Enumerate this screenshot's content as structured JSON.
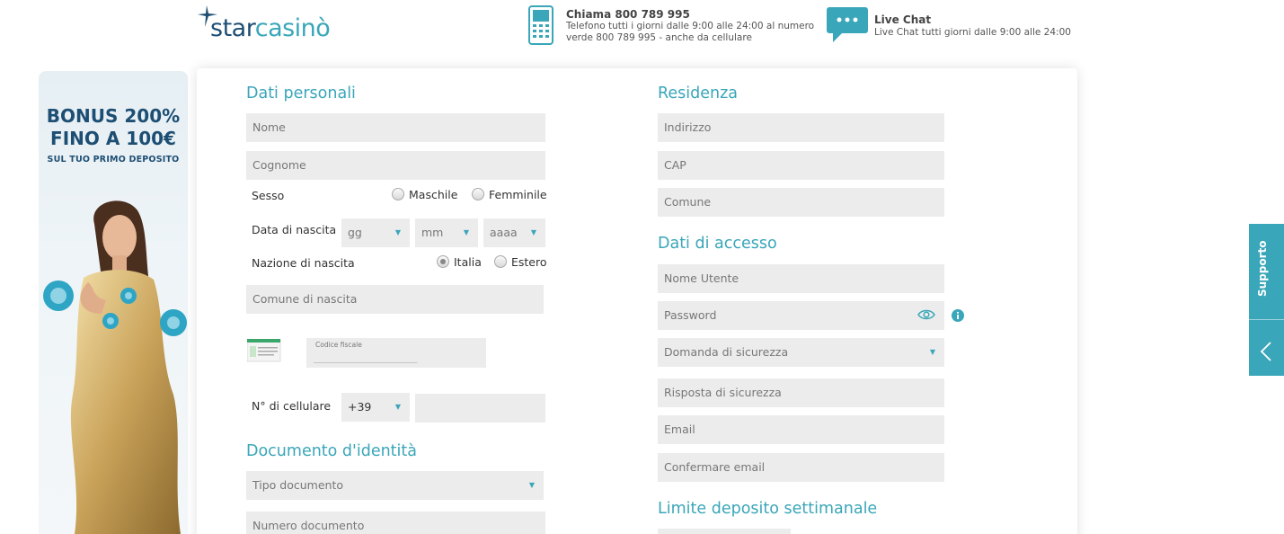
{
  "header": {
    "logo_star": "star",
    "logo_casino": "casinò",
    "phone_title": "Chiama 800 789 995",
    "phone_desc": "Telefono tutti i giorni dalle 9:00 alle 24:00 al numero verde 800 789 995 - anche da cellulare",
    "chat_title": "Live Chat",
    "chat_desc": "Live Chat tutti giorni dalle 9:00 alle 24:00"
  },
  "banner": {
    "line1": "BONUS 200%",
    "line2": "FINO A 100€",
    "sub": "SUL TUO PRIMO DEPOSITO"
  },
  "personal": {
    "title": "Dati personali",
    "nome": "Nome",
    "cognome": "Cognome",
    "sesso_label": "Sesso",
    "maschile": "Maschile",
    "femminile": "Femminile",
    "nascita_label": "Data di nascita",
    "gg": "gg",
    "mm": "mm",
    "aaaa": "aaaa",
    "nazione_label": "Nazione di nascita",
    "italia": "Italia",
    "estero": "Estero",
    "comune_nascita": "Comune di nascita",
    "cf_label": "Codice fiscale",
    "cf_placeholder": "________________",
    "cellulare_label": "N° di cellulare",
    "prefix": "+39"
  },
  "document": {
    "title": "Documento d'identità",
    "tipo": "Tipo documento",
    "numero": "Numero documento"
  },
  "residence": {
    "title": "Residenza",
    "indirizzo": "Indirizzo",
    "cap": "CAP",
    "comune": "Comune"
  },
  "access": {
    "title": "Dati di accesso",
    "nome_utente": "Nome Utente",
    "password": "Password",
    "domanda": "Domanda di sicurezza",
    "risposta": "Risposta di sicurezza",
    "email": "Email",
    "conferma_email": "Confermare email"
  },
  "limit": {
    "title": "Limite deposito settimanale"
  },
  "support": {
    "label": "Supporto"
  },
  "colors": {
    "accent": "#3aa6b9",
    "navy": "#1d4e73",
    "field": "#ececec"
  }
}
